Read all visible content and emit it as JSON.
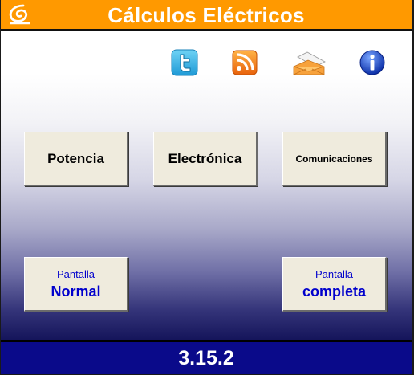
{
  "window": {
    "title": "Cálculos Eléctricos",
    "logo_icon": "spiral-logo-icon",
    "title_bar_color": "#ff9900"
  },
  "toolbar": {
    "icons": [
      "twitter-icon",
      "rss-icon",
      "mail-icon",
      "info-icon"
    ]
  },
  "menu": {
    "potencia_label": "Potencia",
    "electronica_label": "Electrónica",
    "comunicaciones_label": "Comunicaciones"
  },
  "screen_mode": {
    "normal_line1": "Pantalla",
    "normal_line2": "Normal",
    "completa_line1": "Pantalla",
    "completa_line2": "completa"
  },
  "footer": {
    "version": "3.15.2",
    "background_color": "#0a0a8a"
  }
}
